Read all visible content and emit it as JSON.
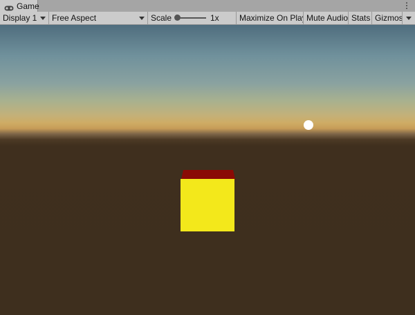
{
  "tab": {
    "label": "Game",
    "icon": "gamepad-icon"
  },
  "menu": {
    "icon": "kebab-menu-icon",
    "glyph": "⋮"
  },
  "toolbar": {
    "display": "Display 1",
    "aspect": "Free Aspect",
    "scale_label": "Scale",
    "scale_value": "1x",
    "maximize": "Maximize On Play",
    "mute": "Mute Audio",
    "stats": "Stats",
    "gizmos": "Gizmos"
  },
  "scene": {
    "colors": {
      "cube_front": "#f3e81b",
      "cube_top": "#8a0a05",
      "ground": "#3e2f1e",
      "sun": "#ffffff"
    }
  }
}
